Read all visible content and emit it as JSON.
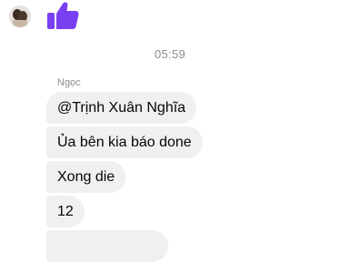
{
  "thread": {
    "timestamp": "05:59",
    "sender_name": "Ngọc",
    "reaction_icon": "thumbs-up-icon",
    "colors": {
      "accent": "#7b3ff2",
      "bubble_bg": "#f0f0f0",
      "meta_text": "#8a8d91"
    },
    "messages": [
      "@Trịnh Xuân Nghĩa",
      "Ủa bên kia báo done",
      "Xong die",
      "12",
      ""
    ]
  }
}
